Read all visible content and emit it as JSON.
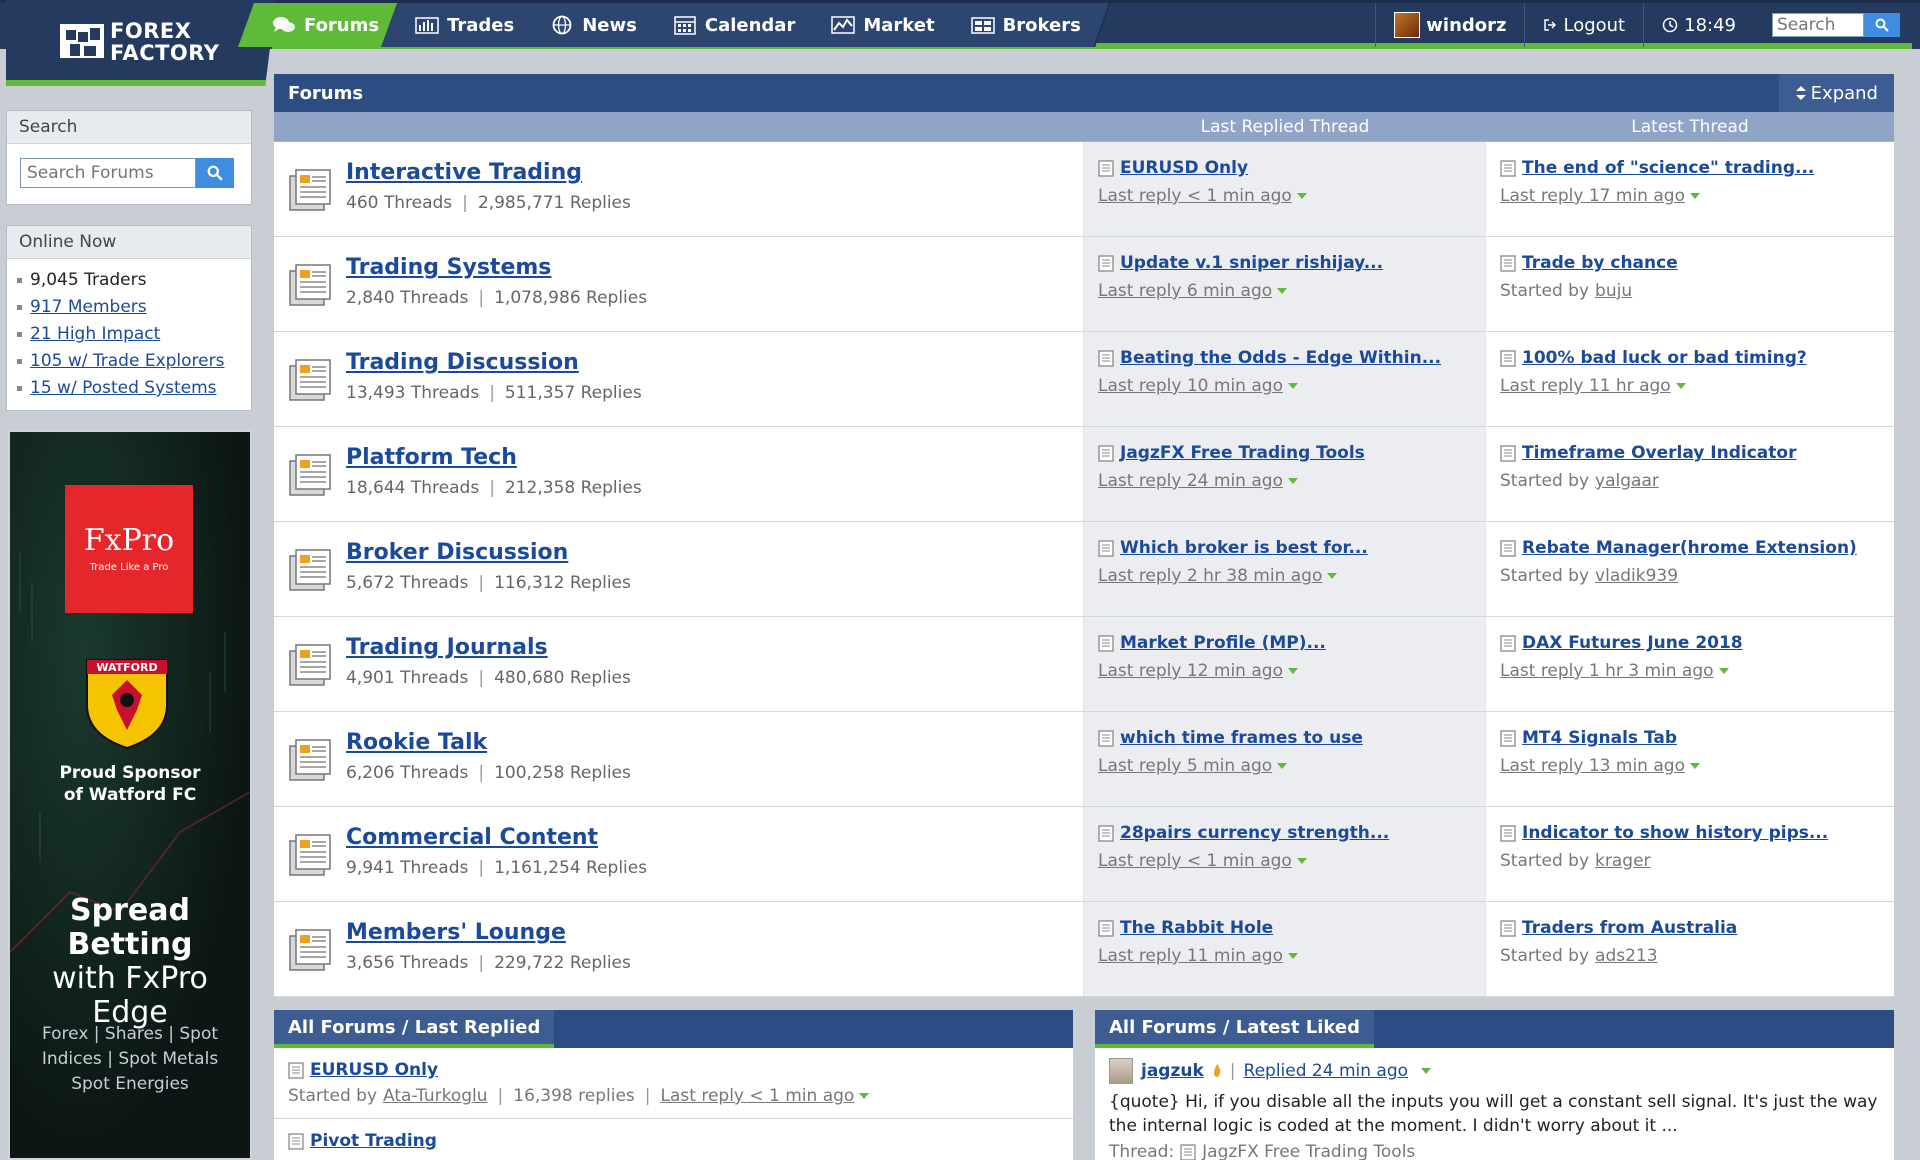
{
  "nav": {
    "tabs": [
      {
        "label": "Forums",
        "icon": "chat-bubbles-icon"
      },
      {
        "label": "Trades",
        "icon": "bar-chart-icon"
      },
      {
        "label": "News",
        "icon": "globe-icon"
      },
      {
        "label": "Calendar",
        "icon": "calendar-icon"
      },
      {
        "label": "Market",
        "icon": "line-chart-icon"
      },
      {
        "label": "Brokers",
        "icon": "brokers-icon"
      }
    ],
    "username": "windorz",
    "logout_label": "Logout",
    "time": "18:49",
    "search_placeholder": "Search"
  },
  "logo": {
    "line1": "FOREX",
    "line2": "FACTORY"
  },
  "sidebar": {
    "search_heading": "Search",
    "search_placeholder": "Search Forums",
    "online_heading": "Online Now",
    "online": [
      {
        "label": "9,045 Traders",
        "link": false
      },
      {
        "label": "917 Members",
        "link": true
      },
      {
        "label": "21 High Impact",
        "link": true
      },
      {
        "label": "105 w/ Trade Explorers",
        "link": true
      },
      {
        "label": "15 w/ Posted Systems",
        "link": true
      }
    ]
  },
  "ad": {
    "brand": "FxPro",
    "tagline": "Trade Like a Pro",
    "club": "WATFORD",
    "sponsor_line1": "Proud Sponsor",
    "sponsor_line2": "of Watford FC",
    "headline1": "Spread Betting",
    "headline2": "with FxPro",
    "headline3": "Edge",
    "products1": "Forex  |  Shares  |  Spot",
    "products2": "Indices  |  Spot Metals",
    "products3": "Spot Energies"
  },
  "forums": {
    "title": "Forums",
    "expand_label": "Expand",
    "col_last_replied": "Last Replied Thread",
    "col_latest": "Latest Thread",
    "rows": [
      {
        "name": "Interactive Trading",
        "threads": "460 Threads",
        "replies": "2,985,771 Replies",
        "lr_title": "EURUSD Only",
        "lr_pre": "",
        "lr_sub": "Last reply < 1 min ago",
        "lr_tri": true,
        "lt_title": "The end of \"science\" trading...",
        "lt_pre": "",
        "lt_sub": "Last reply 17 min ago",
        "lt_tri": true
      },
      {
        "name": "Trading Systems",
        "threads": "2,840 Threads",
        "replies": "1,078,986 Replies",
        "lr_title": "Update v.1 sniper rishijay...",
        "lr_pre": "",
        "lr_sub": "Last reply 6 min ago",
        "lr_tri": true,
        "lt_title": "Trade by chance",
        "lt_pre": "Started by",
        "lt_sub": "buju",
        "lt_tri": false
      },
      {
        "name": "Trading Discussion",
        "threads": "13,493 Threads",
        "replies": "511,357 Replies",
        "lr_title": "Beating the Odds - Edge Within...",
        "lr_pre": "",
        "lr_sub": "Last reply 10 min ago",
        "lr_tri": true,
        "lt_title": "100% bad luck or bad timing?",
        "lt_pre": "",
        "lt_sub": "Last reply 11 hr ago",
        "lt_tri": true
      },
      {
        "name": "Platform Tech",
        "threads": "18,644 Threads",
        "replies": "212,358 Replies",
        "lr_title": "JagzFX Free Trading Tools",
        "lr_pre": "",
        "lr_sub": "Last reply 24 min ago",
        "lr_tri": true,
        "lt_title": "Timeframe Overlay Indicator",
        "lt_pre": "Started by",
        "lt_sub": "yalgaar",
        "lt_tri": false
      },
      {
        "name": "Broker Discussion",
        "threads": "5,672 Threads",
        "replies": "116,312 Replies",
        "lr_title": "Which broker is best for...",
        "lr_pre": "",
        "lr_sub": "Last reply 2 hr 38 min ago",
        "lr_tri": true,
        "lt_title": "Rebate Manager(hrome Extension)",
        "lt_pre": "Started by",
        "lt_sub": "vladik939",
        "lt_tri": false
      },
      {
        "name": "Trading Journals",
        "threads": "4,901 Threads",
        "replies": "480,680 Replies",
        "lr_title": "Market Profile (MP)...",
        "lr_pre": "",
        "lr_sub": "Last reply 12 min ago",
        "lr_tri": true,
        "lt_title": "DAX Futures June 2018",
        "lt_pre": "",
        "lt_sub": "Last reply 1 hr 3 min ago",
        "lt_tri": true
      },
      {
        "name": "Rookie Talk",
        "threads": "6,206 Threads",
        "replies": "100,258 Replies",
        "lr_title": "which time frames to use",
        "lr_pre": "",
        "lr_sub": "Last reply 5 min ago",
        "lr_tri": true,
        "lt_title": "MT4 Signals Tab",
        "lt_pre": "",
        "lt_sub": "Last reply 13 min ago",
        "lt_tri": true
      },
      {
        "name": "Commercial Content",
        "threads": "9,941 Threads",
        "replies": "1,161,254 Replies",
        "lr_title": "28pairs currency strength...",
        "lr_pre": "",
        "lr_sub": "Last reply < 1 min ago",
        "lr_tri": true,
        "lt_title": "Indicator to show history pips...",
        "lt_pre": "Started by",
        "lt_sub": "krager",
        "lt_tri": false
      },
      {
        "name": "Members' Lounge",
        "threads": "3,656 Threads",
        "replies": "229,722 Replies",
        "lr_title": "The Rabbit Hole",
        "lr_pre": "",
        "lr_sub": "Last reply 11 min ago",
        "lr_tri": true,
        "lt_title": "Traders from Australia",
        "lt_pre": "Started by",
        "lt_sub": "ads213",
        "lt_tri": false
      }
    ]
  },
  "bottom_left": {
    "tab": "All Forums / Last Replied",
    "rows": [
      {
        "title": "EURUSD Only",
        "started_pre": "Started by",
        "author": "Ata-Turkoglu",
        "replies": "16,398 replies",
        "last": "Last reply < 1 min ago"
      },
      {
        "title": "Pivot Trading",
        "started_pre": "",
        "author": "",
        "replies": "",
        "last": ""
      }
    ]
  },
  "bottom_right": {
    "tab": "All Forums / Latest Liked",
    "user": "jagzuk",
    "replied": "Replied 24 min ago",
    "text": "{quote} Hi, if you disable all the inputs you will get a constant sell signal. It's just the way the internal logic is coded at the moment. I didn't worry about it ...",
    "thread_pre": "Thread:",
    "thread": "JagzFX Free Trading Tools"
  },
  "colors": {
    "navy": "#243a5e",
    "green": "#5fba3a",
    "link": "#1b4a9a",
    "panel_head": "#2c4d82"
  }
}
